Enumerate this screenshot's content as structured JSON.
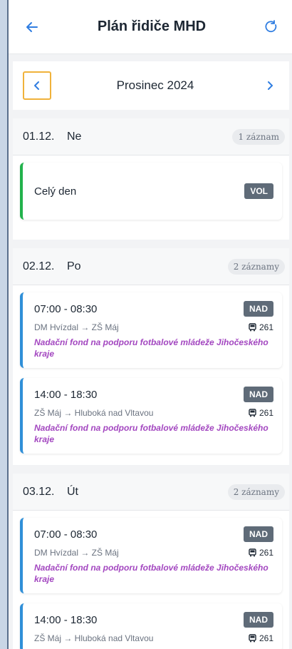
{
  "header": {
    "title": "Plán řidiče MHD"
  },
  "month": {
    "label": "Prosinec 2024"
  },
  "days": [
    {
      "date": "01.12.",
      "name": "Ne",
      "count": "1 záznam",
      "entries": [
        {
          "label": "Celý den",
          "badge": "VOL"
        }
      ]
    },
    {
      "date": "02.12.",
      "name": "Po",
      "count": "2 záznamy",
      "entries": [
        {
          "time": "07:00 - 08:30",
          "badge": "NAD",
          "route": "DM Hvízdal → ZŠ Máj",
          "bus": "261",
          "org": "Nadační fond na podporu fotbalové mládeže Jihočeského kraje"
        },
        {
          "time": "14:00 - 18:30",
          "badge": "NAD",
          "route": "ZŠ Máj → Hluboká nad Vltavou",
          "bus": "261",
          "org": "Nadační fond na podporu fotbalové mládeže Jihočeského kraje"
        }
      ]
    },
    {
      "date": "03.12.",
      "name": "Út",
      "count": "2 záznamy",
      "entries": [
        {
          "time": "07:00 - 08:30",
          "badge": "NAD",
          "route": "DM Hvízdal → ZŠ Máj",
          "bus": "261",
          "org": "Nadační fond na podporu fotbalové mládeže Jihočeského kraje"
        },
        {
          "time": "14:00 - 18:30",
          "badge": "NAD",
          "route": "ZŠ Máj → Hluboká nad Vltavou",
          "bus": "261"
        }
      ]
    }
  ],
  "colors": {
    "accent": "#2f7de1",
    "entry_border": "#2f8fd8",
    "free_border": "#22b24c",
    "org_text": "#a347c0"
  },
  "icons": {
    "back": "arrow-left-icon",
    "refresh": "refresh-icon",
    "prev": "chevron-left-icon",
    "next": "chevron-right-icon",
    "bus": "bus-icon"
  }
}
